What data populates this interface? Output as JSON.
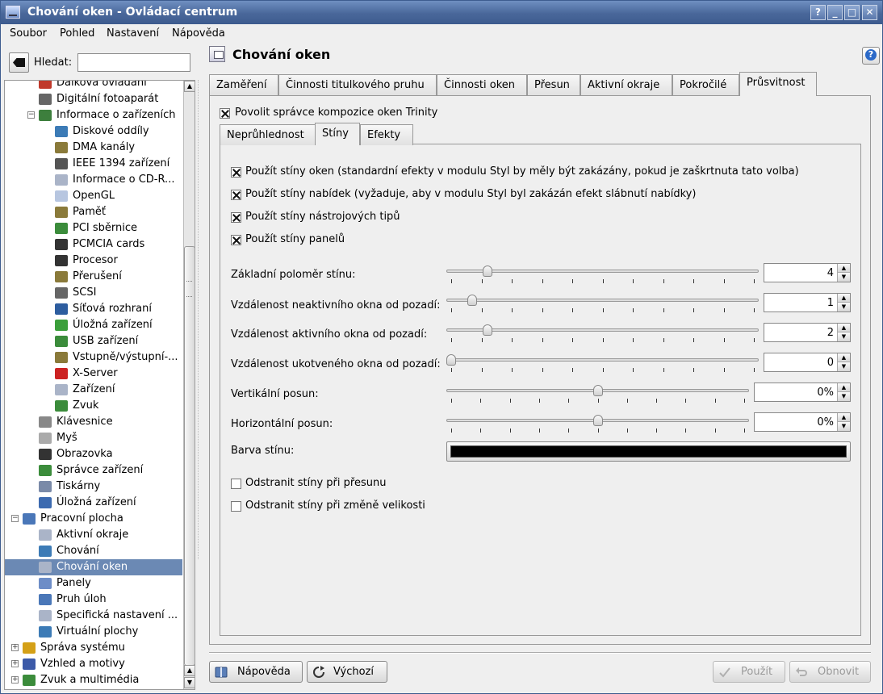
{
  "window": {
    "title": "Chování oken - Ovládací centrum"
  },
  "titlebar_buttons": [
    "?",
    "_",
    "□",
    "✕"
  ],
  "menu": [
    "Soubor",
    "Pohled",
    "Nastavení",
    "Nápověda"
  ],
  "search": {
    "label": "Hledat:",
    "value": ""
  },
  "tree": {
    "items": [
      {
        "label": "Dálková ovládání",
        "level": 2,
        "icon": "remote-icon",
        "color": "#c0392b"
      },
      {
        "label": "Digitální fotoaparát",
        "level": 2,
        "icon": "camera-icon",
        "color": "#666"
      },
      {
        "label": "Informace o zařízeních",
        "level": 2,
        "icon": "info-devices-icon",
        "color": "#3d7f3d",
        "expanded": true
      },
      {
        "label": "Diskové oddíly",
        "level": 3,
        "icon": "disk-partition-icon",
        "color": "#3c7bb6"
      },
      {
        "label": "DMA kanály",
        "level": 3,
        "icon": "dma-icon",
        "color": "#8a7a3a"
      },
      {
        "label": "IEEE 1394 zařízení",
        "level": 3,
        "icon": "ieee1394-icon",
        "color": "#555"
      },
      {
        "label": "Informace o CD-R...",
        "level": 3,
        "icon": "cdrom-icon",
        "color": "#aab4c8"
      },
      {
        "label": "OpenGL",
        "level": 3,
        "icon": "opengl-icon",
        "color": "#b7c6e0"
      },
      {
        "label": "Paměť",
        "level": 3,
        "icon": "memory-icon",
        "color": "#8a7a3a"
      },
      {
        "label": "PCI sběrnice",
        "level": 3,
        "icon": "pci-icon",
        "color": "#3b8c3b"
      },
      {
        "label": "PCMCIA cards",
        "level": 3,
        "icon": "pcmcia-icon",
        "color": "#333"
      },
      {
        "label": "Procesor",
        "level": 3,
        "icon": "cpu-icon",
        "color": "#333"
      },
      {
        "label": "Přerušení",
        "level": 3,
        "icon": "interrupt-icon",
        "color": "#8a7a3a"
      },
      {
        "label": "SCSI",
        "level": 3,
        "icon": "scsi-icon",
        "color": "#666"
      },
      {
        "label": "Síťová rozhraní",
        "level": 3,
        "icon": "network-icon",
        "color": "#2d5d9f"
      },
      {
        "label": "Úložná zařízení",
        "level": 3,
        "icon": "storage-icon",
        "color": "#3b9f3b"
      },
      {
        "label": "USB zařízení",
        "level": 3,
        "icon": "usb-icon",
        "color": "#3b8c3b"
      },
      {
        "label": "Vstupně/výstupní-...",
        "level": 3,
        "icon": "io-ports-icon",
        "color": "#8a7a3a"
      },
      {
        "label": "X-Server",
        "level": 3,
        "icon": "xserver-icon",
        "color": "#cc2222"
      },
      {
        "label": "Zařízení",
        "level": 3,
        "icon": "devices-icon",
        "color": "#aab4c8"
      },
      {
        "label": "Zvuk",
        "level": 3,
        "icon": "sound-icon",
        "color": "#3b8c3b"
      },
      {
        "label": "Klávesnice",
        "level": 2,
        "icon": "keyboard-icon",
        "color": "#888"
      },
      {
        "label": "Myš",
        "level": 2,
        "icon": "mouse-icon",
        "color": "#aaa"
      },
      {
        "label": "Obrazovka",
        "level": 2,
        "icon": "display-icon",
        "color": "#333"
      },
      {
        "label": "Správce zařízení",
        "level": 2,
        "icon": "device-manager-icon",
        "color": "#3b8c3b"
      },
      {
        "label": "Tiskárny",
        "level": 2,
        "icon": "printer-icon",
        "color": "#7a8aa8"
      },
      {
        "label": "Úložná zařízení",
        "level": 2,
        "icon": "storage-media-icon",
        "color": "#3c6ab0"
      },
      {
        "label": "Pracovní plocha",
        "level": 1,
        "icon": "desktop-icon",
        "color": "#4a77b8",
        "expanded": true
      },
      {
        "label": "Aktivní okraje",
        "level": 2,
        "icon": "active-borders-icon",
        "color": "#aab4c8"
      },
      {
        "label": "Chování",
        "level": 2,
        "icon": "behavior-icon",
        "color": "#3c7bb6"
      },
      {
        "label": "Chování oken",
        "level": 2,
        "icon": "window-behavior-icon",
        "color": "#aab4c8",
        "selected": true
      },
      {
        "label": "Panely",
        "level": 2,
        "icon": "panels-icon",
        "color": "#6d8dc7"
      },
      {
        "label": "Pruh úloh",
        "level": 2,
        "icon": "taskbar-icon",
        "color": "#4a77b8"
      },
      {
        "label": "Specifická nastavení ...",
        "level": 2,
        "icon": "window-specific-icon",
        "color": "#aab4c8"
      },
      {
        "label": "Virtuální plochy",
        "level": 2,
        "icon": "virtual-desktops-icon",
        "color": "#3c7bb6"
      },
      {
        "label": "Správa systému",
        "level": 1,
        "icon": "system-admin-icon",
        "color": "#d4a017",
        "expandable": true
      },
      {
        "label": "Vzhled a motivy",
        "level": 1,
        "icon": "appearance-icon",
        "color": "#3c5aa8",
        "expandable": true
      },
      {
        "label": "Zvuk a multimédia",
        "level": 1,
        "icon": "sound-multimedia-icon",
        "color": "#3b8c3b",
        "expandable": true
      }
    ]
  },
  "header": {
    "title": "Chování oken"
  },
  "tabs": [
    "Zaměření",
    "Činnosti titulkového pruhu",
    "Činnosti oken",
    "Přesun",
    "Aktivní okraje",
    "Pokročilé",
    "Průsvitnost"
  ],
  "active_tab": "Průsvitnost",
  "enable_composition": {
    "label": "Povolit správce kompozice oken Trinity",
    "checked": true
  },
  "subtabs": [
    "Neprůhlednost",
    "Stíny",
    "Efekty"
  ],
  "active_subtab": "Stíny",
  "shadow_checks": [
    {
      "label": "Použít stíny oken (standardní efekty v modulu Styl by měly být zakázány, pokud je zaškrtnuta tato volba)",
      "checked": true
    },
    {
      "label": "Použít stíny nabídek (vyžaduje, aby v modulu Styl byl zakázán efekt slábnutí nabídky)",
      "checked": true
    },
    {
      "label": "Použít stíny nástrojových tipů",
      "checked": true
    },
    {
      "label": "Použít stíny panelů",
      "checked": true
    }
  ],
  "sliders": [
    {
      "label": "Základní poloměr stínu:",
      "value": "4",
      "fraction": 0.12
    },
    {
      "label": "Vzdálenost neaktivního okna od pozadí:",
      "value": "1",
      "fraction": 0.07
    },
    {
      "label": "Vzdálenost aktivního okna od pozadí:",
      "value": "2",
      "fraction": 0.12
    },
    {
      "label": "Vzdálenost ukotveného okna od pozadí:",
      "value": "0",
      "fraction": 0.0
    },
    {
      "label": "Vertikální posun:",
      "value": "0%",
      "fraction": 0.5
    },
    {
      "label": "Horizontální posun:",
      "value": "0%",
      "fraction": 0.5
    }
  ],
  "shadow_color": {
    "label": "Barva stínu:",
    "value": "#000000"
  },
  "bottom_checks": [
    {
      "label": "Odstranit stíny při přesunu",
      "checked": false
    },
    {
      "label": "Odstranit stíny při změně velikosti",
      "checked": false
    }
  ],
  "buttons": {
    "help": "Nápověda",
    "defaults": "Výchozí",
    "apply": "Použít",
    "reset": "Obnovit"
  }
}
